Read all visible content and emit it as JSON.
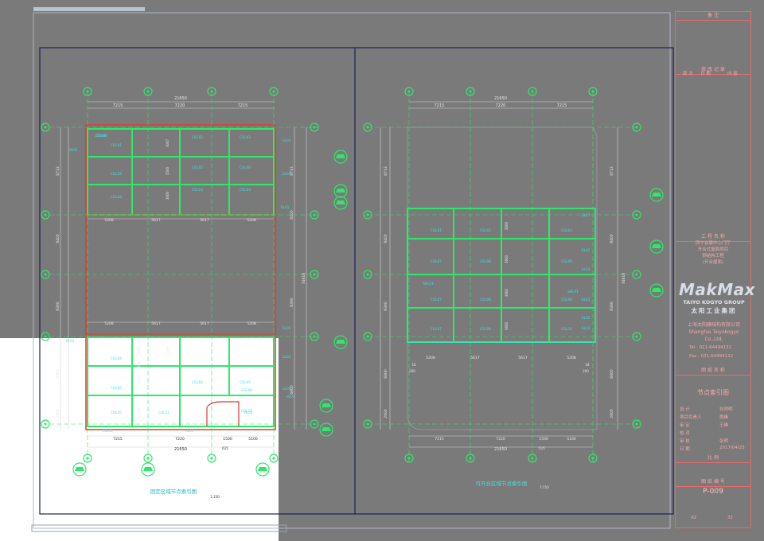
{
  "titleblock": {
    "remarks_header": "备 注",
    "rev_header": "修 改 记 录",
    "rev_cols": [
      "版 次",
      "日 期",
      "内 容"
    ],
    "project_header": "工 程 名 称",
    "project_lines": [
      "西宁会展中心门厅",
      "开合式屋面项目",
      "钢结构工程",
      "(开合屋面)"
    ],
    "logo_text": "MakMax",
    "group_en": "TAIYO KOGYO GROUP",
    "group_cn": "太阳工业集团",
    "company_cn": "上海太阳膜结构有限公司",
    "company_en": "Shanghai Taiyokogyo Co.,Ltd.",
    "tel": "Tel : 021-64494131",
    "fax": "Fax : 021-64494132",
    "drawing_name_header": "图 纸 名 称",
    "drawing_name": "节点索引图",
    "sign_rows": [
      [
        "设 计",
        "刘帅明"
      ],
      [
        "项目负责人",
        "周峰"
      ],
      [
        "审 定",
        "王峰"
      ],
      [
        "校 对",
        ""
      ],
      [
        "审 核",
        "张明"
      ],
      [
        "日 期",
        "2017/04/25"
      ]
    ],
    "scale_header": "比 例",
    "drawing_no_header": "图 纸 编 号",
    "drawing_no": "P-009",
    "sheet": [
      "A2",
      "32"
    ]
  },
  "left_plan": {
    "title": "固定区域节点索引图",
    "scale": "1:150",
    "overall_dim": "21650",
    "spans": [
      "7215",
      "7220",
      "7215"
    ],
    "inner_spans": [
      "5208",
      "5617",
      "5617",
      "5208"
    ],
    "right_dims": [
      "8713",
      "8400",
      "8390",
      "6900"
    ],
    "right_total": "34618",
    "left_dims": [
      "8713",
      "8400",
      "8390",
      "6900",
      "2900"
    ],
    "labels_upper": [
      "CGL04",
      "CGL01",
      "CGL02",
      "CGL03",
      "CGL04",
      "CGL05",
      "CGL06",
      "CGL04",
      "CGL03",
      "CGL03",
      "CGL06"
    ],
    "labels_lower": [
      "CGL04",
      "CGL05",
      "CGL04",
      "CGL05",
      "CGL10",
      "CGL09",
      "CGL11",
      "CGL11",
      "CGL01"
    ],
    "hl_labels": [
      "HL01",
      "HL01",
      "HL02",
      "HL03",
      "HL04"
    ],
    "gl_labels": [
      "GL01",
      "GL01",
      "GL01",
      "GL01",
      "GL01",
      "GL01"
    ],
    "inner_vert": [
      "3007",
      "3500",
      "3000",
      "3000",
      "2200",
      "3300",
      "2500",
      "2900"
    ],
    "bottom_dims": [
      "7215",
      "7220",
      "1500",
      "5100"
    ],
    "bottom_total": "21650",
    "bottom_small": "615"
  },
  "right_plan": {
    "title": "可开合区域节点索引图",
    "scale": "1:150",
    "overall_dim": "21650",
    "spans": [
      "7215",
      "7220",
      "7215"
    ],
    "inner_spans": [
      "5208",
      "5617",
      "5617",
      "5208"
    ],
    "labels": [
      "CGL01",
      "CGL02",
      "CGL03",
      "CGL07",
      "CGL08",
      "CGL09",
      "CGL07",
      "CGL08",
      "CGL09",
      "CGL07",
      "CGL08",
      "CGL10"
    ],
    "gl_labels": [
      "GL01",
      "GL02",
      "GL03",
      "GL02",
      "GL03",
      "GL03"
    ],
    "shl_labels": [
      "SHL01",
      "SHL01"
    ],
    "inner_vert": [
      "3600",
      "3600",
      "3600",
      "3600"
    ],
    "right_dims": [
      "8713",
      "8400",
      "8390",
      "6900",
      "2900"
    ],
    "right_total": "34618",
    "bottom_dims": [
      "7215",
      "7220",
      "1500",
      "5100"
    ],
    "bottom_total": "21650",
    "bottom_small": "615",
    "marks": [
      "18",
      "200",
      "18",
      "200"
    ]
  },
  "colors": {
    "background": "#7a7a7a",
    "frame": "#1d2154",
    "grid": "#2ee86a",
    "cyan": "#3ee0e0",
    "red": "#e23a2a",
    "titleblock": "#e46c6c"
  }
}
